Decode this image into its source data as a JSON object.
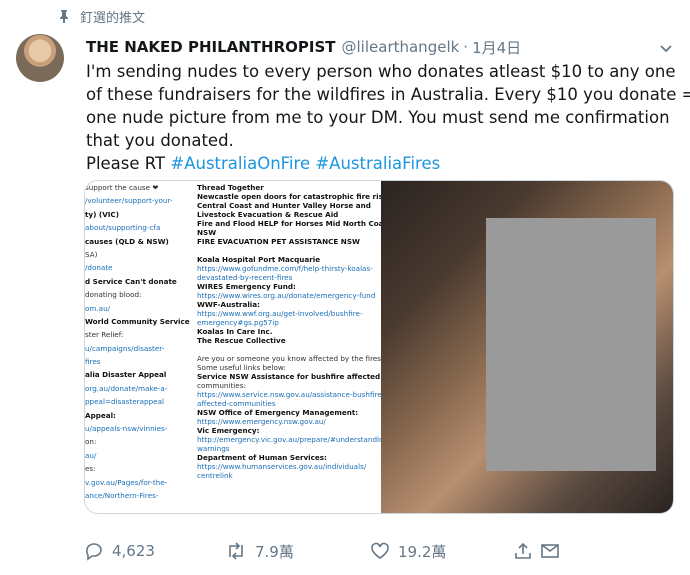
{
  "pinned": {
    "label": "釘選的推文",
    "icon": "pin-icon"
  },
  "author": {
    "name": "THE NAKED PHILANTHROPIST",
    "handle": "@lilearthangelk",
    "separator": "·",
    "date": "1月4日"
  },
  "tweet": {
    "lines": [
      "I'm sending nudes to every person who donates atleast $10 to any one",
      "of these fundraisers for the wildfires in Australia. Every $10 you donate =",
      "one nude picture from me to your DM. You must send me confirmation",
      "that you donated."
    ],
    "last_line_prefix": "Please RT ",
    "hashtag1": "#AustraliaOnFire",
    "hashtag2": "#AustraliaFires"
  },
  "media_left_col": [
    {
      "t": "support the cause ❤",
      "s": "n"
    },
    {
      "t": "/volunteer/support-your-",
      "s": "l"
    },
    {
      "t": "ty) (VIC)",
      "s": "b"
    },
    {
      "t": "about/supporting-cfa",
      "s": "l"
    },
    {
      "t": "causes (QLD & NSW)",
      "s": "b"
    },
    {
      "t": "SA)",
      "s": "n"
    },
    {
      "t": "/donate",
      "s": "l"
    },
    {
      "t": "d Service Can't donate",
      "s": "b"
    },
    {
      "t": "donating blood:",
      "s": "n"
    },
    {
      "t": "om.au/",
      "s": "l"
    },
    {
      "t": "World Community Service",
      "s": "b"
    },
    {
      "t": "ster Relief:",
      "s": "n"
    },
    {
      "t": "u/campaigns/disaster-",
      "s": "l"
    },
    {
      "t": "fires",
      "s": "l"
    },
    {
      "t": "alia Disaster Appeal",
      "s": "b"
    },
    {
      "t": "org.au/donate/make-a-",
      "s": "l"
    },
    {
      "t": "ppeal=disasterappeal",
      "s": "l"
    },
    {
      "t": "Appeal:",
      "s": "b"
    },
    {
      "t": "u/appeals-nsw/vinnies-",
      "s": "l"
    },
    {
      "t": "on:",
      "s": "n"
    },
    {
      "t": "au/",
      "s": "l"
    },
    {
      "t": "es:",
      "s": "n"
    },
    {
      "t": "v.gov.au/Pages/for-the-",
      "s": "l"
    },
    {
      "t": "ance/Northern-Fires-",
      "s": "l"
    }
  ],
  "media_right_col": [
    {
      "t": "Thread Together",
      "s": "b"
    },
    {
      "t": "Newcastle open doors for catastrophic fire risk",
      "s": "b"
    },
    {
      "t": "Central Coast and Hunter Valley Horse and",
      "s": "b"
    },
    {
      "t": "Livestock Evacuation & Rescue Aid",
      "s": "b"
    },
    {
      "t": "Fire and Flood HELP for Horses Mid North Coast",
      "s": "b"
    },
    {
      "t": "NSW",
      "s": "b"
    },
    {
      "t": "FIRE EVACUATION PET ASSISTANCE NSW",
      "s": "b"
    },
    {
      "t": "",
      "s": "n"
    },
    {
      "t": "Koala Hospital Port Macquarie",
      "s": "b"
    },
    {
      "t": "https://www.gofundme.com/f/help-thirsty-koalas-",
      "s": "l"
    },
    {
      "t": "devastated-by-recent-fires",
      "s": "l"
    },
    {
      "t": "WIRES Emergency Fund:",
      "s": "b"
    },
    {
      "t": "https://www.wires.org.au/donate/emergency-fund",
      "s": "l"
    },
    {
      "t": "WWF-Australia:",
      "s": "b"
    },
    {
      "t": "https://www.wwf.org.au/get-involved/bushfire-",
      "s": "l"
    },
    {
      "t": "emergency#gs.pg57ip",
      "s": "l"
    },
    {
      "t": "Koalas In Care Inc.",
      "s": "b"
    },
    {
      "t": "The Rescue Collective",
      "s": "b"
    },
    {
      "t": "",
      "s": "n"
    },
    {
      "t": "Are you or someone you know affected by the fires?",
      "s": "n"
    },
    {
      "t": "Some useful links below:",
      "s": "n"
    },
    {
      "t": "Service NSW Assistance for bushfire affected",
      "s": "b"
    },
    {
      "t": "communities:",
      "s": "n"
    },
    {
      "t": "https://www.service.nsw.gov.au/assistance-bushfire-",
      "s": "l"
    },
    {
      "t": "affected-communities",
      "s": "l"
    },
    {
      "t": "NSW Office of Emergency Management:",
      "s": "b"
    },
    {
      "t": "https://www.emergency.nsw.gov.au/",
      "s": "l"
    },
    {
      "t": "Vic Emergency:",
      "s": "b"
    },
    {
      "t": "http://emergency.vic.gov.au/prepare/#understanding-",
      "s": "l"
    },
    {
      "t": "warnings",
      "s": "l"
    },
    {
      "t": "Department of Human Services:",
      "s": "b"
    },
    {
      "t": "https://www.humanservices.gov.au/individuals/",
      "s": "l"
    },
    {
      "t": "centrelink",
      "s": "l"
    }
  ],
  "actions": {
    "reply": {
      "icon": "reply-icon",
      "count": "4,623"
    },
    "retweet": {
      "icon": "retweet-icon",
      "count": "7.9萬"
    },
    "like": {
      "icon": "heart-icon",
      "count": "19.2萬"
    },
    "share": {
      "icon": "share-icon"
    },
    "mail": {
      "icon": "mail-icon"
    }
  },
  "colors": {
    "link": "#1b95e0",
    "muted": "#657786",
    "text": "#14171a"
  }
}
